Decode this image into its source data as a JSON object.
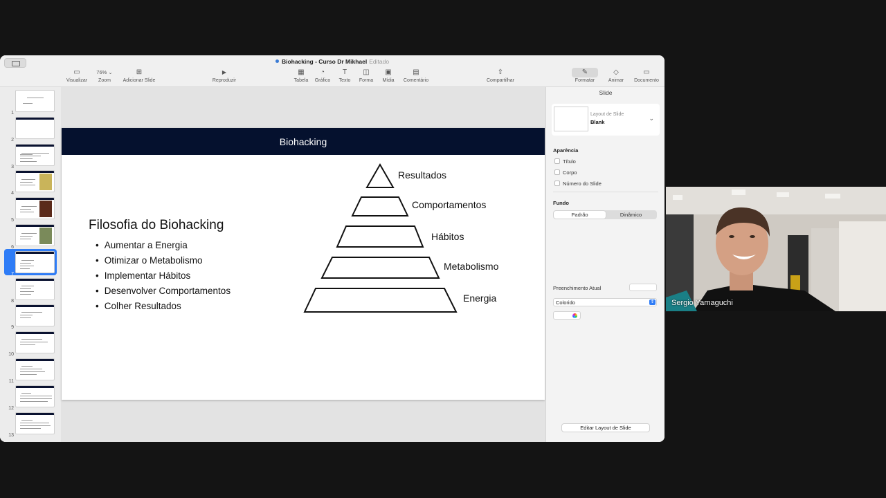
{
  "window": {
    "title": "Biohacking - Curso Dr Mikhael",
    "status": "Editado"
  },
  "toolbar": {
    "visualizar": "Visualizar",
    "zoom_value": "76%",
    "zoom": "Zoom",
    "adicionar_slide": "Adicionar Slide",
    "reproduzir": "Reproduzir",
    "tabela": "Tabela",
    "grafico": "Gráfico",
    "texto": "Texto",
    "forma": "Forma",
    "midia": "Mídia",
    "comentario": "Comentário",
    "compartilhar": "Compartilhar",
    "formatar": "Formatar",
    "animar": "Animar",
    "documento": "Documento"
  },
  "navigator": {
    "slides": [
      {
        "num": "1"
      },
      {
        "num": "2"
      },
      {
        "num": "3"
      },
      {
        "num": "4"
      },
      {
        "num": "5"
      },
      {
        "num": "6"
      },
      {
        "num": "7"
      },
      {
        "num": "8"
      },
      {
        "num": "9"
      },
      {
        "num": "10"
      },
      {
        "num": "11"
      },
      {
        "num": "12"
      },
      {
        "num": "13"
      }
    ],
    "selected": "7"
  },
  "slide": {
    "header": "Biohacking",
    "heading": "Filosofia do Biohacking",
    "bullets": [
      "Aumentar a Energia",
      "Otimizar o Metabolismo",
      "Implementar Hábitos",
      "Desenvolver Comportamentos",
      "Colher Resultados"
    ],
    "pyramid": [
      "Resultados",
      "Comportamentos",
      "Hábitos",
      "Metabolismo",
      "Energia"
    ]
  },
  "inspector": {
    "tab": "Slide",
    "layout_label": "Layout de Slide",
    "layout_value": "Blank",
    "aparencia": "Aparência",
    "titulo": "Título",
    "corpo": "Corpo",
    "numero": "Número do Slide",
    "fundo": "Fundo",
    "padrao": "Padrão",
    "dinamico": "Dinâmico",
    "preenchimento": "Preenchimento Atual",
    "colorido": "Colorido",
    "editar_layout": "Editar Layout de Slide"
  },
  "video": {
    "name": "Sergio Yamaguchi"
  },
  "colors": {
    "slide_header_bg": "#05112e",
    "selection_blue": "#2e7cf6"
  }
}
